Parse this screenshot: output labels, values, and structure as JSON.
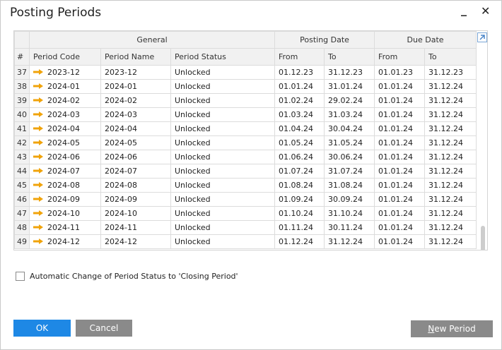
{
  "window": {
    "title": "Posting Periods"
  },
  "grid": {
    "group_headers": {
      "general": "General",
      "posting_date": "Posting Date",
      "due_date": "Due Date"
    },
    "columns": [
      "#",
      "Period Code",
      "Period Name",
      "Period Status",
      "From",
      "To",
      "From",
      "To"
    ],
    "rows": [
      {
        "num": "37",
        "code": "2023-12",
        "name": "2023-12",
        "status": "Unlocked",
        "post_from": "01.12.23",
        "post_to": "31.12.23",
        "due_from": "01.01.23",
        "due_to": "31.12.23"
      },
      {
        "num": "38",
        "code": "2024-01",
        "name": "2024-01",
        "status": "Unlocked",
        "post_from": "01.01.24",
        "post_to": "31.01.24",
        "due_from": "01.01.24",
        "due_to": "31.12.24"
      },
      {
        "num": "39",
        "code": "2024-02",
        "name": "2024-02",
        "status": "Unlocked",
        "post_from": "01.02.24",
        "post_to": "29.02.24",
        "due_from": "01.01.24",
        "due_to": "31.12.24"
      },
      {
        "num": "40",
        "code": "2024-03",
        "name": "2024-03",
        "status": "Unlocked",
        "post_from": "01.03.24",
        "post_to": "31.03.24",
        "due_from": "01.01.24",
        "due_to": "31.12.24"
      },
      {
        "num": "41",
        "code": "2024-04",
        "name": "2024-04",
        "status": "Unlocked",
        "post_from": "01.04.24",
        "post_to": "30.04.24",
        "due_from": "01.01.24",
        "due_to": "31.12.24"
      },
      {
        "num": "42",
        "code": "2024-05",
        "name": "2024-05",
        "status": "Unlocked",
        "post_from": "01.05.24",
        "post_to": "31.05.24",
        "due_from": "01.01.24",
        "due_to": "31.12.24"
      },
      {
        "num": "43",
        "code": "2024-06",
        "name": "2024-06",
        "status": "Unlocked",
        "post_from": "01.06.24",
        "post_to": "30.06.24",
        "due_from": "01.01.24",
        "due_to": "31.12.24"
      },
      {
        "num": "44",
        "code": "2024-07",
        "name": "2024-07",
        "status": "Unlocked",
        "post_from": "01.07.24",
        "post_to": "31.07.24",
        "due_from": "01.01.24",
        "due_to": "31.12.24"
      },
      {
        "num": "45",
        "code": "2024-08",
        "name": "2024-08",
        "status": "Unlocked",
        "post_from": "01.08.24",
        "post_to": "31.08.24",
        "due_from": "01.01.24",
        "due_to": "31.12.24"
      },
      {
        "num": "46",
        "code": "2024-09",
        "name": "2024-09",
        "status": "Unlocked",
        "post_from": "01.09.24",
        "post_to": "30.09.24",
        "due_from": "01.01.24",
        "due_to": "31.12.24"
      },
      {
        "num": "47",
        "code": "2024-10",
        "name": "2024-10",
        "status": "Unlocked",
        "post_from": "01.10.24",
        "post_to": "31.10.24",
        "due_from": "01.01.24",
        "due_to": "31.12.24"
      },
      {
        "num": "48",
        "code": "2024-11",
        "name": "2024-11",
        "status": "Unlocked",
        "post_from": "01.11.24",
        "post_to": "30.11.24",
        "due_from": "01.01.24",
        "due_to": "31.12.24"
      },
      {
        "num": "49",
        "code": "2024-12",
        "name": "2024-12",
        "status": "Unlocked",
        "post_from": "01.12.24",
        "post_to": "31.12.24",
        "due_from": "01.01.24",
        "due_to": "31.12.24"
      }
    ]
  },
  "options": {
    "auto_change_label": "Automatic Change of Period Status to 'Closing Period'",
    "auto_change_checked": false
  },
  "buttons": {
    "ok": "OK",
    "cancel": "Cancel",
    "new_period_first": "N",
    "new_period_rest": "ew Period"
  },
  "colors": {
    "primary": "#1e88e5",
    "secondary": "#8a8a8a",
    "link_arrow": "#f0a30a"
  },
  "icons": {
    "row_link": "orange-arrow-icon",
    "expand": "expand-icon"
  }
}
